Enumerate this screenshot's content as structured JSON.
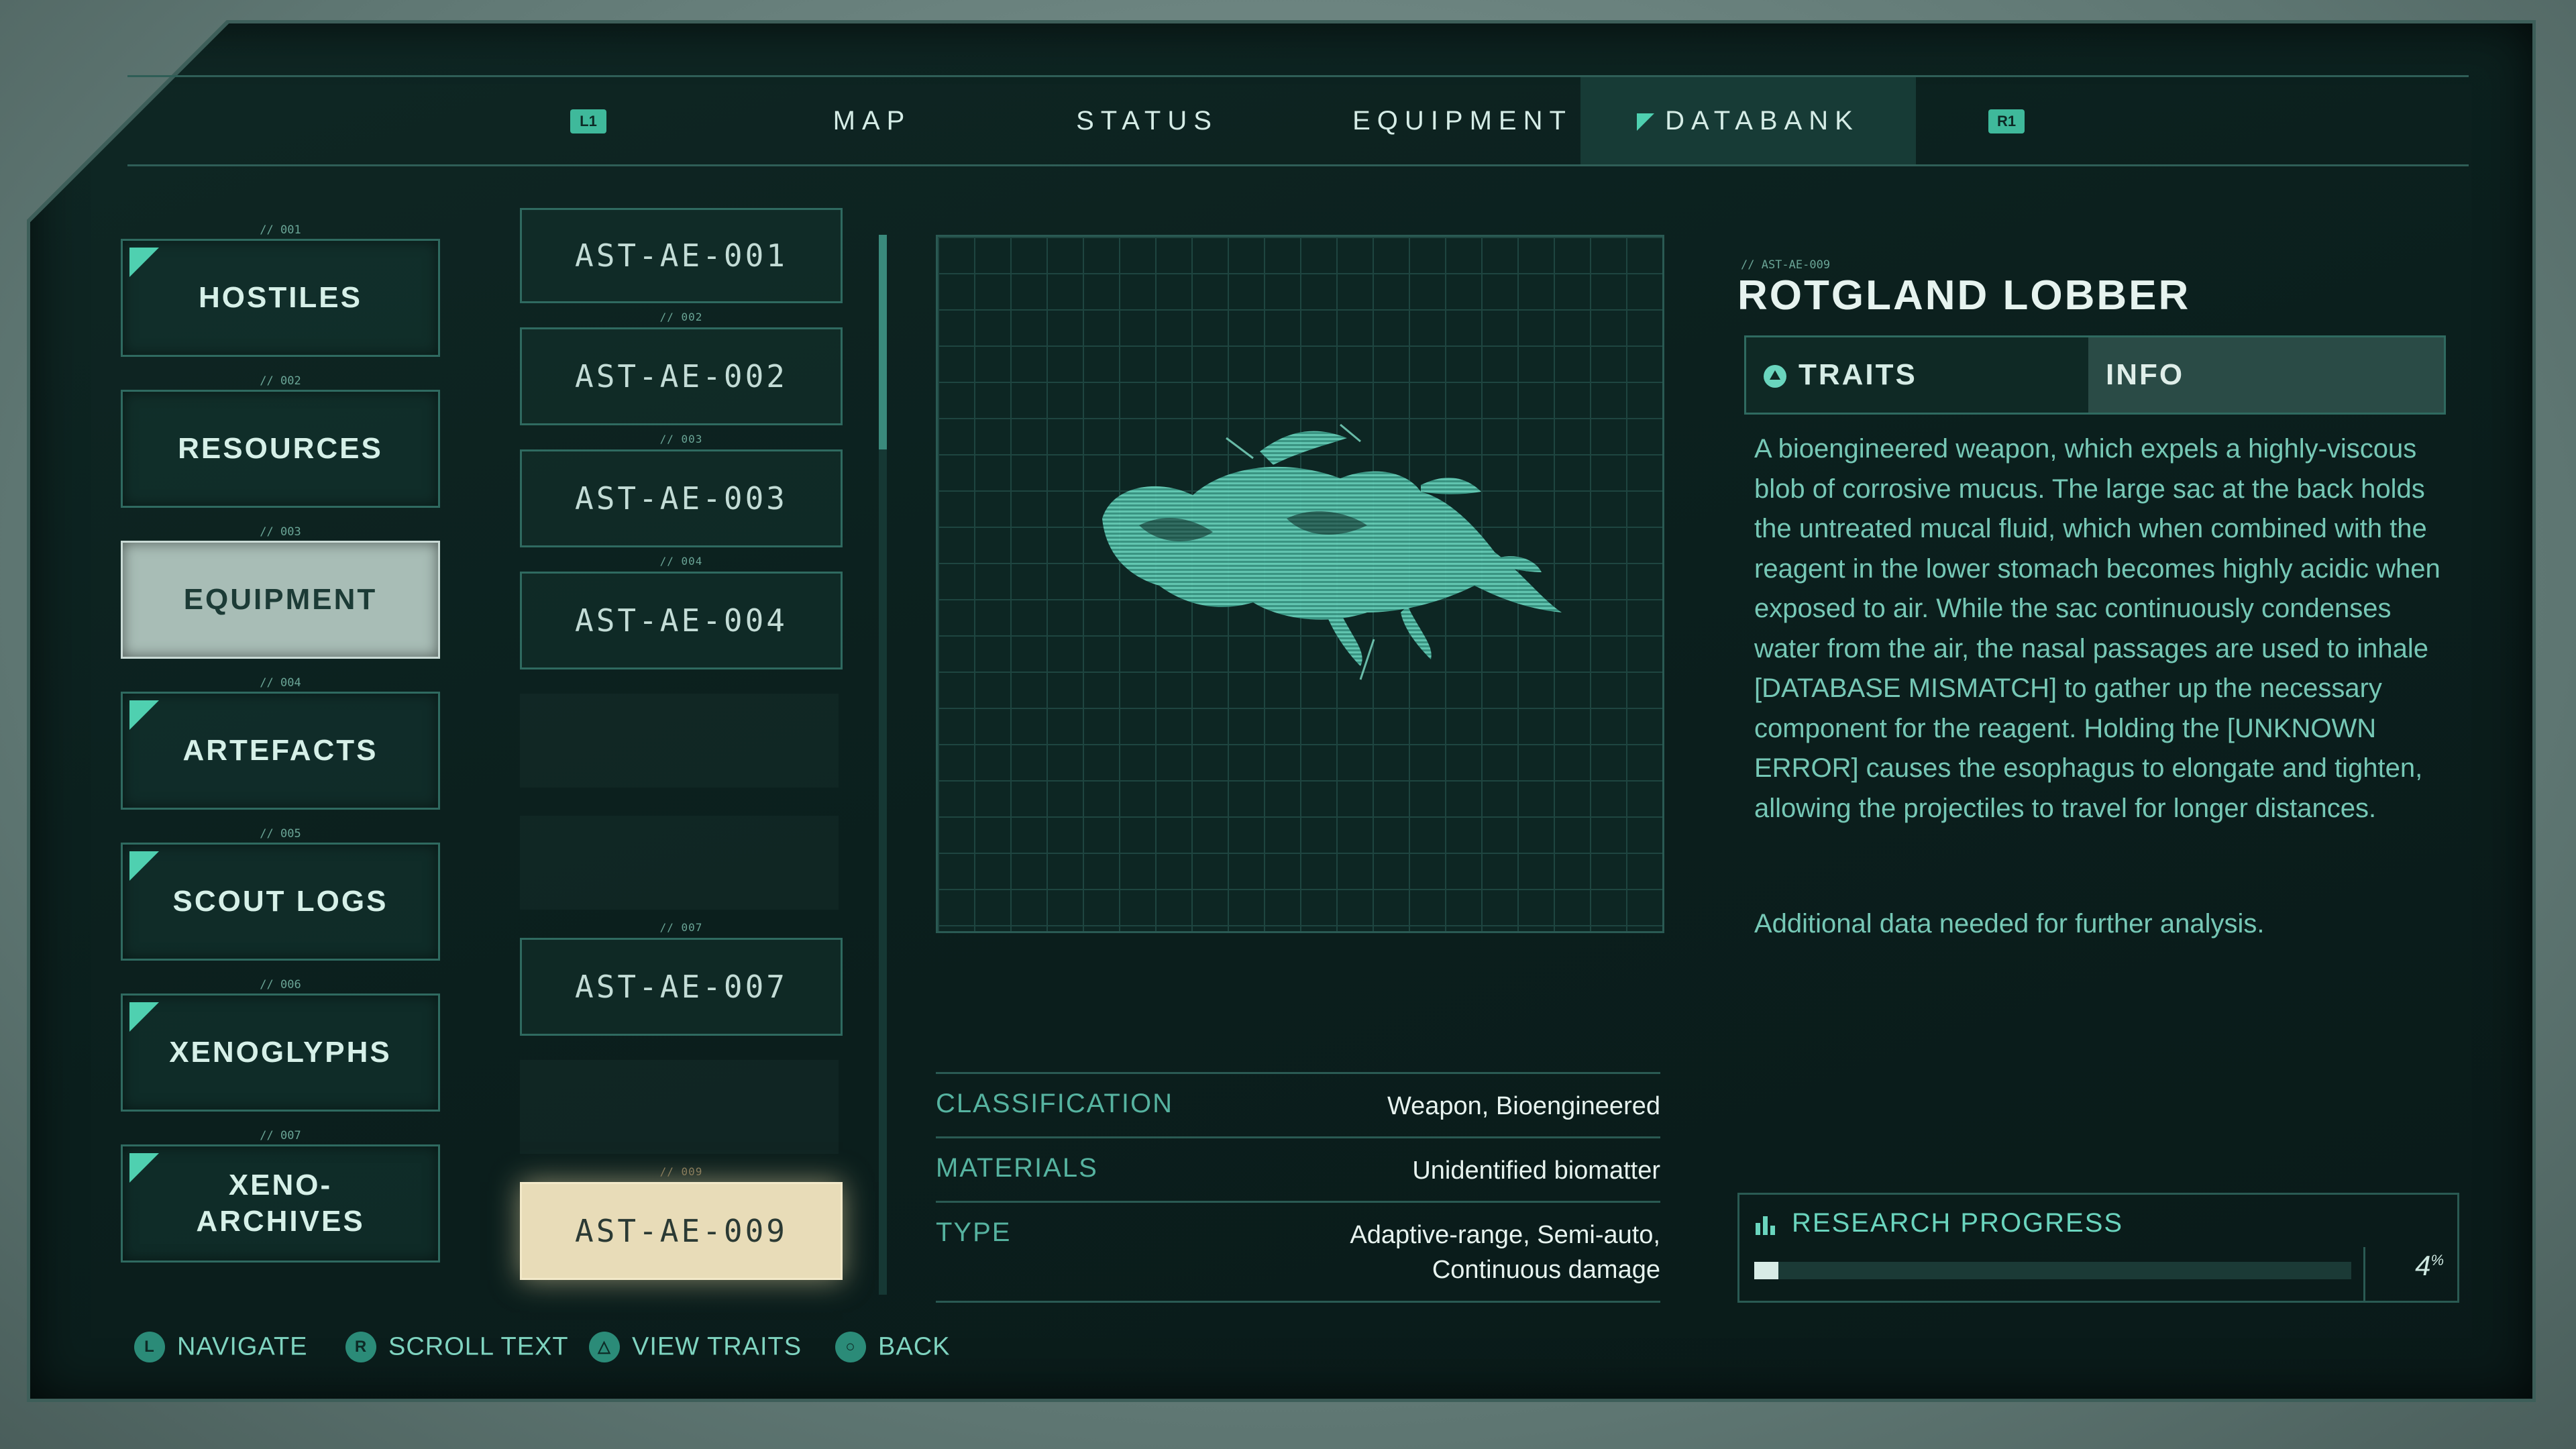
{
  "topnav": {
    "left_bumper": "L1",
    "right_bumper": "R1",
    "tabs": [
      {
        "label": "MAP",
        "active": false
      },
      {
        "label": "STATUS",
        "active": false
      },
      {
        "label": "EQUIPMENT",
        "active": false
      },
      {
        "label": "DATABANK",
        "active": true
      }
    ]
  },
  "categories": [
    {
      "num": "// 001",
      "label": "HOSTILES",
      "new": true,
      "selected": false
    },
    {
      "num": "// 002",
      "label": "RESOURCES",
      "new": false,
      "selected": false
    },
    {
      "num": "// 003",
      "label": "EQUIPMENT",
      "new": false,
      "selected": true
    },
    {
      "num": "// 004",
      "label": "ARTEFACTS",
      "new": true,
      "selected": false
    },
    {
      "num": "// 005",
      "label": "SCOUT LOGS",
      "new": true,
      "selected": false
    },
    {
      "num": "// 006",
      "label": "XENOGLYPHS",
      "new": true,
      "selected": false
    },
    {
      "num": "// 007",
      "label": "XENO-\nARCHIVES",
      "new": true,
      "selected": false
    }
  ],
  "entries": [
    {
      "num": "",
      "label": "AST-AE-001"
    },
    {
      "num": "// 002",
      "label": "AST-AE-002"
    },
    {
      "num": "// 003",
      "label": "AST-AE-003"
    },
    {
      "num": "// 004",
      "label": "AST-AE-004"
    },
    {
      "num": "",
      "label": ""
    },
    {
      "num": "",
      "label": ""
    },
    {
      "num": "// 007",
      "label": "AST-AE-007"
    },
    {
      "num": "",
      "label": ""
    },
    {
      "num": "// 009",
      "label": "AST-AE-009"
    }
  ],
  "stats": [
    {
      "key": "CLASSIFICATION",
      "value": "Weapon, Bioengineered"
    },
    {
      "key": "MATERIALS",
      "value": "Unidentified biomatter"
    },
    {
      "key": "TYPE",
      "value": "Adaptive-range, Semi-auto,\nContinuous damage"
    }
  ],
  "detail": {
    "id": "// AST-AE-009",
    "title": "ROTGLAND LOBBER",
    "tab_traits": "TRAITS",
    "tab_info": "INFO",
    "description": "A bioengineered weapon, which expels a highly-viscous blob of corrosive mucus. The large sac at the back holds the untreated mucal fluid, which when combined with the reagent in the lower stomach becomes highly acidic when exposed to air. While the sac continuously condenses water from the air, the nasal passages are used to inhale [DATABASE MISMATCH] to gather up the necessary component for the reagent. Holding the [UNKNOWN ERROR] causes the esophagus to elongate and tighten, allowing the projectiles to travel for longer distances.",
    "note": "Additional data needed for further analysis."
  },
  "research": {
    "title": "RESEARCH PROGRESS",
    "percent": 4,
    "percent_label": "4",
    "percent_unit": "%"
  },
  "footer": [
    {
      "button": "L",
      "label": "NAVIGATE"
    },
    {
      "button": "R",
      "label": "SCROLL TEXT"
    },
    {
      "button": "△",
      "label": "VIEW TRAITS"
    },
    {
      "button": "○",
      "label": "BACK"
    }
  ],
  "colors": {
    "accent": "#4fd0b0",
    "panel": "#0f2724",
    "selected_entry": "#e8dcb8"
  }
}
